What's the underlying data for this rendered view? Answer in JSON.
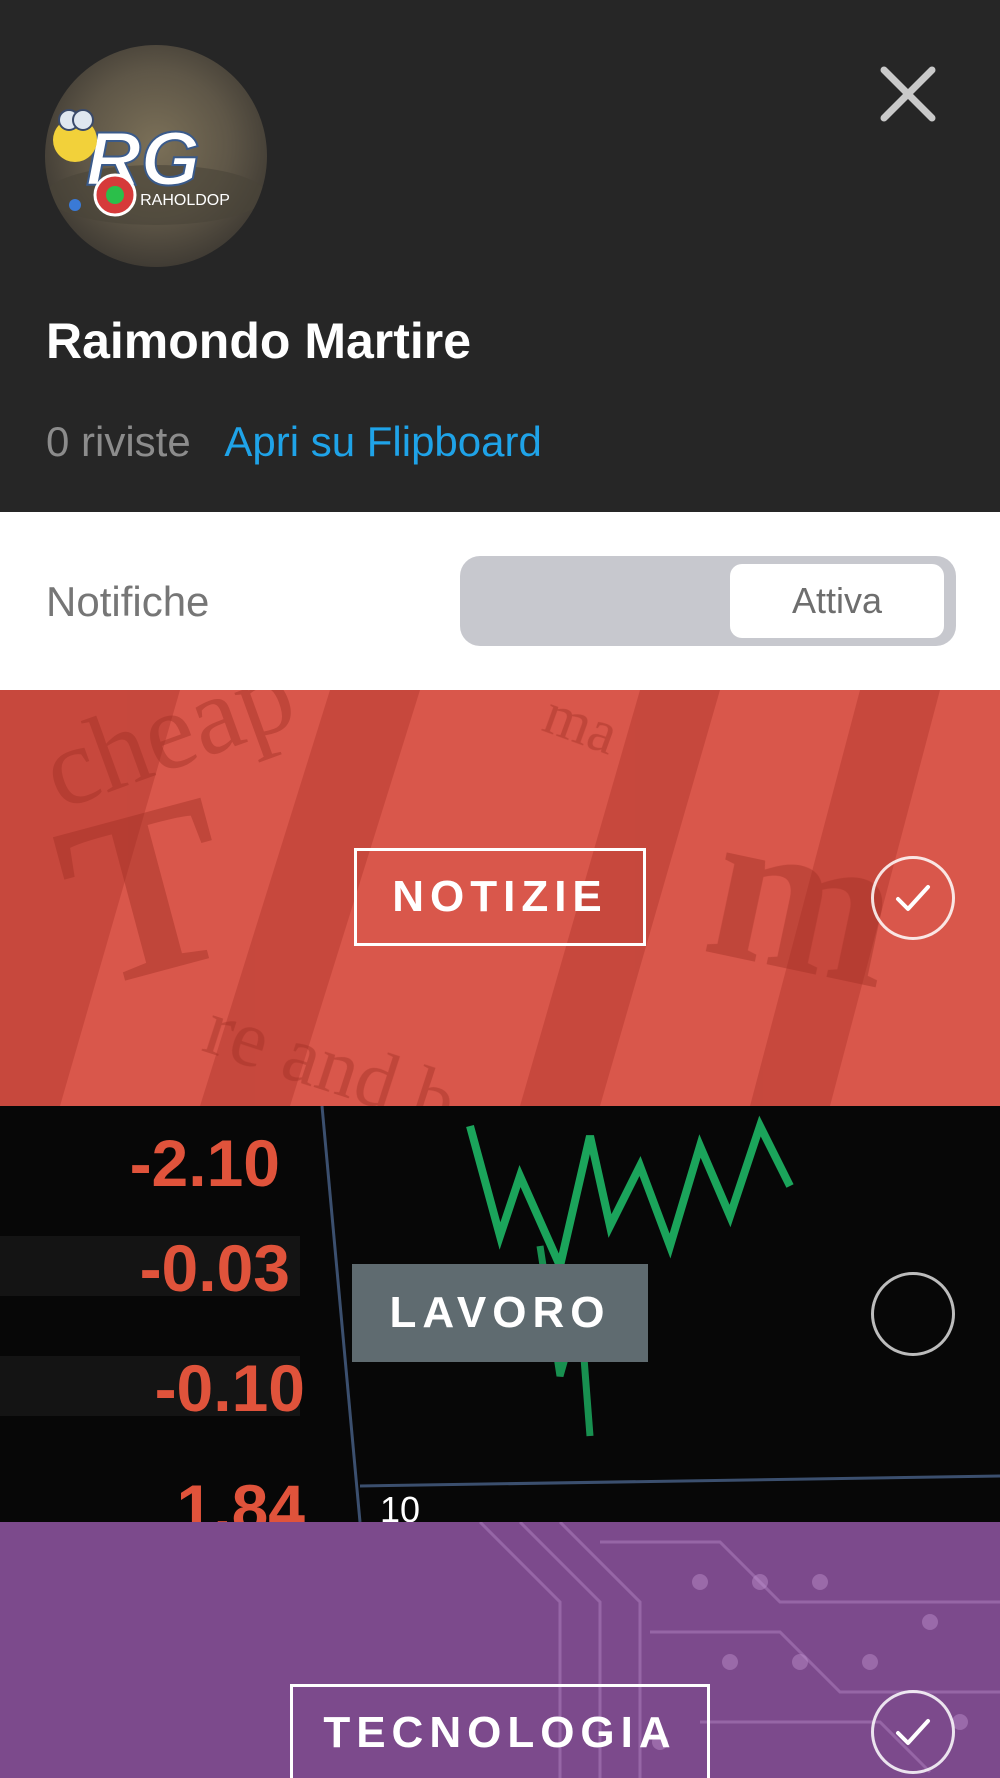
{
  "profile": {
    "name": "Raimondo Martire",
    "magazine_count": "0 riviste",
    "open_link": "Apri su Flipboard",
    "avatar_logo_text": "RG",
    "avatar_logo_subtext": "RAHOLDOP"
  },
  "notifications": {
    "label": "Notifiche",
    "toggle_label": "Attiva"
  },
  "topics": [
    {
      "label": "NOTIZIE",
      "selected": true,
      "color": "#d9574b"
    },
    {
      "label": "LAVORO",
      "selected": false,
      "color": "#0a0a0a"
    },
    {
      "label": "TECNOLOGIA",
      "selected": true,
      "color": "#7c4a8c"
    }
  ],
  "finance_ticker": [
    "-2.10",
    "-0.03",
    "-0.10",
    "1.84",
    "10"
  ],
  "icons": {
    "close": "close-icon",
    "check": "checkmark-icon"
  }
}
